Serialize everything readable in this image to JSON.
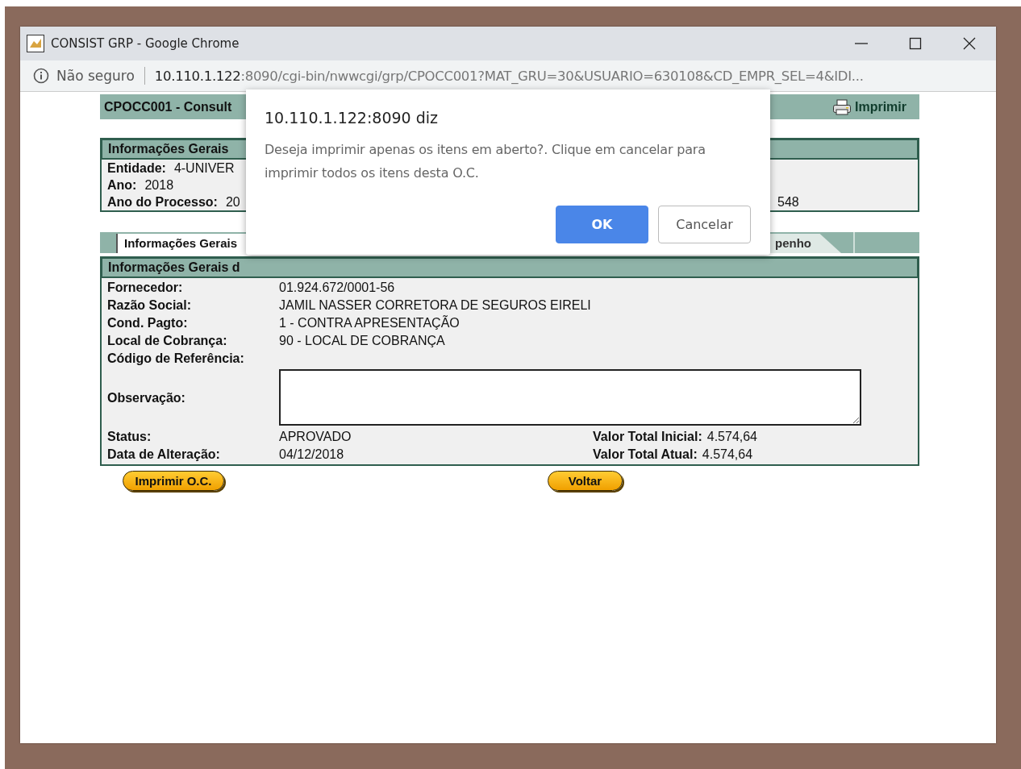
{
  "window": {
    "title": "CONSIST GRP - Google Chrome"
  },
  "address_bar": {
    "security": "Não seguro",
    "host": "10.110.1.122",
    "path": ":8090/cgi-bin/nwwcgi/grp/CPOCC001?MAT_GRU=30&USUARIO=630108&CD_EMPR_SEL=4&IDI..."
  },
  "page_header": {
    "title": "CPOCC001 - Consult",
    "print_label": "Imprimir"
  },
  "general_info": {
    "heading": "Informações Gerais",
    "fields": [
      {
        "label": "Entidade:",
        "value": "4-UNIVER"
      },
      {
        "label": "Ano:",
        "value": "2018"
      },
      {
        "label": "Ano do Processo:",
        "value": "20"
      }
    ],
    "right_value": "548"
  },
  "tabs": [
    {
      "label": "Informações Gerais",
      "selected": true
    },
    {
      "label": "penho",
      "selected": false
    }
  ],
  "order_info": {
    "heading": "Informações Gerais d",
    "fields": [
      {
        "label": "Fornecedor:",
        "value": "01.924.672/0001-56"
      },
      {
        "label": "Razão Social:",
        "value": "JAMIL NASSER CORRETORA DE SEGUROS EIRELI"
      },
      {
        "label": "Cond. Pagto:",
        "value": "1 - CONTRA APRESENTAÇÃO"
      },
      {
        "label": "Local de Cobrança:",
        "value": "90 - LOCAL DE COBRANÇA"
      },
      {
        "label": "Código de Referência:"
      }
    ],
    "observation": {
      "label": "Observação:"
    },
    "summary": [
      {
        "label": "Status:",
        "value": "APROVADO",
        "total_label": "Valor Total Inicial:",
        "total_value": "4.574,64"
      },
      {
        "label": "Data de Alteração:",
        "value": "04/12/2018",
        "total_label": "Valor Total Atual:",
        "total_value": "4.574,64"
      }
    ]
  },
  "buttons": [
    "Imprimir O.C.",
    "Voltar"
  ],
  "dialog": {
    "title": "10.110.1.122:8090 diz",
    "message": "Deseja imprimir apenas os itens em aberto?. Clique em cancelar para imprimir todos os itens desta O.C.",
    "buttons": [
      {
        "label": "OK",
        "default": true
      },
      {
        "label": "Cancelar",
        "default": false
      }
    ]
  }
}
